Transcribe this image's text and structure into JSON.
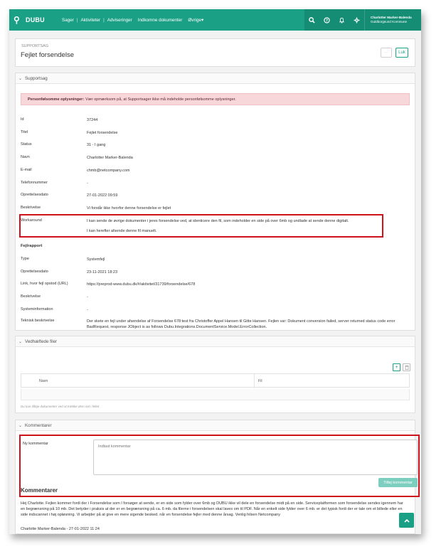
{
  "app": {
    "logo": "DUBU"
  },
  "nav": [
    "Sager",
    "Aktiviteter",
    "Adviseringer",
    "Indkomne dokumenter",
    "Øvrige"
  ],
  "user": {
    "name": "Charlotter Marker-Balenda",
    "org": "Guldborgsund Kommune"
  },
  "header": {
    "breadcrumb": "SUPPORTSAG",
    "title": "Fejlet forsendelse",
    "more_label": "···",
    "close_label": "Luk"
  },
  "support": {
    "panel_title": "Supportsag",
    "alert_bold": "Personfølsomme oplysninger:",
    "alert_text": "Vær opmærksom på, at Supportsager ikke må indeholde personfølsomme oplysninger.",
    "fields": [
      {
        "label": "Id",
        "value": "37244"
      },
      {
        "label": "Titel",
        "value": "Fejlet forsendelse"
      },
      {
        "label": "Status",
        "value": "31 - I gang"
      },
      {
        "label": "Navn",
        "value": "Charlotter Marker-Balenda"
      },
      {
        "label": "E-mail",
        "value": "chmb@netcompany.com"
      },
      {
        "label": "Telefonnummer",
        "value": "-"
      },
      {
        "label": "Oprettelsesdato",
        "value": "27-01-2022 09:59"
      },
      {
        "label": "Beskrivelse",
        "value": "Vi forstår ikke hvorfor denne forsendelse er fejlet"
      }
    ],
    "workaround_label": "Workaround",
    "workaround_line1": "I kan sende de øvrige dokumenter i jeres forsendelse ved, at identicere den fil, som indeholder en side på over 6mb og undlade at  sende denne digitalt.",
    "workaround_line2": "I kan herefter afsende denne fil manuelt."
  },
  "fejlrapport": {
    "title": "Fejlrapport",
    "fields": [
      {
        "label": "Type",
        "value": "Systemfejl"
      },
      {
        "label": "Oprettelsesdato",
        "value": "23-11-2021 18:23"
      },
      {
        "label": "Link, hvor fejl opstod (URL)",
        "value": "https://preprod-www.dubu.dk/#/aktivitet/31739/forsendelse/678"
      },
      {
        "label": "Beskrivelse",
        "value": "-"
      },
      {
        "label": "Systeminformation",
        "value": "-"
      },
      {
        "label": "Teknisk beskrivelse",
        "value": "Der skete en fejl under afsendelse af Forsendelse 678:test fra Christoffer Appel Hansen til Gitte Hansen. Fejlen var: Dokument conversion failed, server returned status code error BadRequest, response JObject is as follows Dubu.Integrations.DocumentService.Model.ErrorCollection."
      }
    ]
  },
  "files": {
    "panel_title": "Vedhæftede filer",
    "add_label": "+",
    "delete_label": "🗑",
    "col_name": "Navn",
    "col_file": "Fil",
    "hint": "Du kan tilføje dokumenter ved at trække dem ind i feltet."
  },
  "comments": {
    "panel_title": "Kommentarer",
    "new_label": "Ny kommentar",
    "placeholder": "Indtast kommentar",
    "add_button": "Tilføj kommentar",
    "list_title": "Kommentarer",
    "items": [
      {
        "text": "Hej Charlotte. Fejlen kommer fordi der i Forsendelse som I forsøger at sende, er en side som fylder over 6mb og DUBU ikke vil dele en forsendelse midt på en side. Serviceplatformen som forsendelse sendes igennem har en begrænsning på 10 mb. Det betyder i praksis at der er en begrænsning på ca. 6 mb. da filerne i forsendelsen skal laves om til PDF. Når en enkelt side fylder over 6 mb. er det typisk fordi der er tale om et billede eller en side indscannet i høj opløsning. Vi arbejder på at give en mere sigende besked. når en forsendelse fejler med denne årsag. Venlig hilsen Netcompany",
        "meta": "Charlotte Marker-Balenda - 27-01-2022 11:24"
      }
    ]
  },
  "colors": {
    "brand": "#1aa085",
    "highlight": "#d0121c",
    "alert_bg": "#f8d7da"
  }
}
